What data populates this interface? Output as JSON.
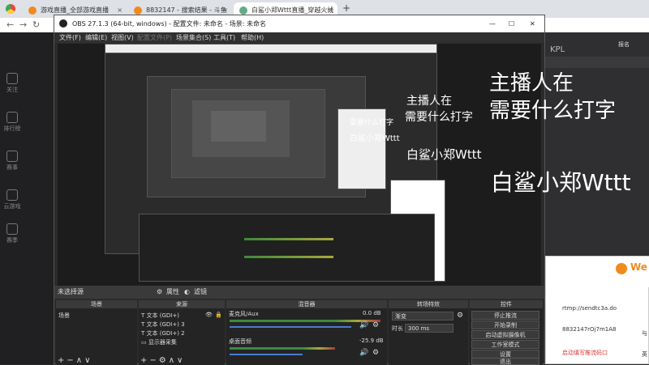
{
  "browser": {
    "tabs": [
      {
        "label": "游戏直播_全部游戏直播"
      },
      {
        "label": "8832147 - 搜索结果 - 斗鱼"
      },
      {
        "label": "白鲨小郑Wttt直播_穿越火线"
      }
    ],
    "new_tab": "+"
  },
  "site": {
    "nav": [
      {
        "label": "关注"
      },
      {
        "label": "排行榜"
      },
      {
        "label": "赛事"
      },
      {
        "label": "云游戏"
      },
      {
        "label": "赛季"
      }
    ],
    "kpl": "KPL",
    "banner_right": "报名"
  },
  "obs": {
    "title": "OBS 27.1.3 (64-bit, windows) - 配置文件: 未命名 - 场景: 未命名",
    "menu": [
      "文件(F)",
      "编辑(E)",
      "视图(V)",
      "配置文件(P)",
      "场景集合(S)",
      "工具(T)",
      "帮助(H)"
    ],
    "status_left": "未选择源",
    "props_button": "属性",
    "filters_button": "滤镜",
    "docks": {
      "scenes": {
        "title": "场景",
        "items": [
          "场景"
        ]
      },
      "sources": {
        "title": "来源",
        "items": [
          "文本 (GDI+)",
          "文本 (GDI+) 3",
          "文本 (GDI+) 2",
          "显示器采集"
        ]
      },
      "mixer": {
        "title": "混音器",
        "channels": [
          {
            "name": "麦克风/Aux",
            "db": "0.0 dB"
          },
          {
            "name": "桌面音频",
            "db": "-25.9 dB"
          }
        ]
      },
      "transitions": {
        "title": "转场特效",
        "type": "渐变",
        "duration_label": "时长",
        "duration": "300 ms"
      },
      "controls": {
        "title": "控件",
        "buttons": [
          "停止推流",
          "开始录制",
          "启动虚拟摄像机",
          "工作室模式",
          "设置",
          "退出"
        ]
      }
    },
    "overlays": {
      "text1_line1": "主播人在",
      "text1_line2": "需要什么打字",
      "text2": "白鲨小郑Wttt"
    }
  },
  "douyu_panel": {
    "brand": "We",
    "url": "rtmp://sendtc3a.do",
    "key": "8832147rOj7m1A8",
    "warning": "启动填写推流码口",
    "opt1": "与",
    "opt2": "英"
  },
  "colors": {
    "accent": "#4a7bd0",
    "brand_orange": "#f08a1c"
  }
}
